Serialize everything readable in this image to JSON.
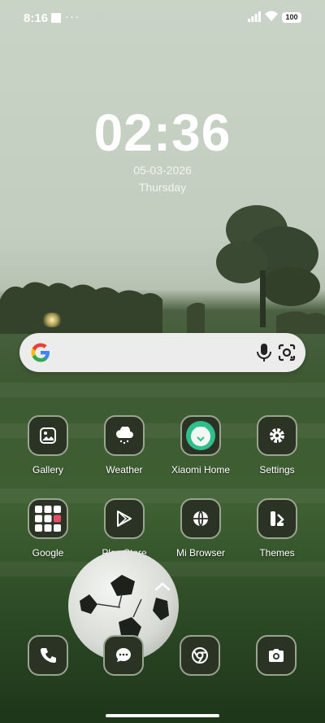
{
  "status": {
    "time": "8:16",
    "dots": "···",
    "battery": "100"
  },
  "lock": {
    "clock": "02:36",
    "date": "05-03-2026",
    "day": "Thursday"
  },
  "apps": [
    {
      "label": "Gallery",
      "icon": "gallery-icon"
    },
    {
      "label": "Weather",
      "icon": "weather-icon"
    },
    {
      "label": "Xiaomi Home",
      "icon": "xiaomi-home-icon"
    },
    {
      "label": "Settings",
      "icon": "gear-icon"
    },
    {
      "label": "Google",
      "icon": "google-folder-icon"
    },
    {
      "label": "Play Store",
      "icon": "play-store-icon"
    },
    {
      "label": "Mi Browser",
      "icon": "globe-icon"
    },
    {
      "label": "Themes",
      "icon": "themes-icon"
    }
  ],
  "dock": [
    "phone-icon",
    "messages-icon",
    "chrome-icon",
    "camera-icon"
  ],
  "colors": {
    "tile_bg": "#2b3325",
    "tile_border": "#9aa58f",
    "accent": "#ffffff"
  }
}
